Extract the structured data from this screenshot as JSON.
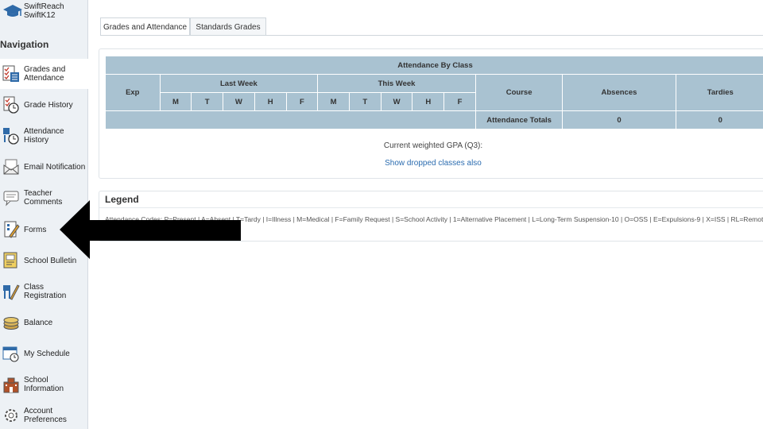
{
  "brand": {
    "line1": "SwiftReach",
    "line2": "SwiftK12"
  },
  "navigation": {
    "heading": "Navigation",
    "items": [
      {
        "label": "Grades and Attendance",
        "icon": "grades-attendance-icon",
        "active": true
      },
      {
        "label": "Grade History",
        "icon": "grade-history-icon"
      },
      {
        "label": "Attendance History",
        "icon": "attendance-history-icon"
      },
      {
        "label": "Email Notification",
        "icon": "email-icon"
      },
      {
        "label": "Teacher Comments",
        "icon": "comments-icon"
      },
      {
        "label": "Forms",
        "icon": "forms-icon"
      },
      {
        "label": "School Bulletin",
        "icon": "bulletin-icon"
      },
      {
        "label": "Class Registration",
        "icon": "registration-icon"
      },
      {
        "label": "Balance",
        "icon": "balance-icon"
      },
      {
        "label": "My Schedule",
        "icon": "schedule-icon"
      },
      {
        "label": "School Information",
        "icon": "school-icon"
      },
      {
        "label": "Account Preferences",
        "icon": "preferences-icon"
      }
    ]
  },
  "tabs": [
    {
      "label": "Grades and Attendance",
      "active": true
    },
    {
      "label": "Standards Grades",
      "active": false
    }
  ],
  "attendance": {
    "title": "Attendance By Class",
    "exp_header": "Exp",
    "last_week_header": "Last Week",
    "this_week_header": "This Week",
    "course_header": "Course",
    "absences_header": "Absences",
    "tardies_header": "Tardies",
    "days": [
      "M",
      "T",
      "W",
      "H",
      "F"
    ],
    "totals_label": "Attendance Totals",
    "totals_absences": "0",
    "totals_tardies": "0"
  },
  "gpa_text": "Current weighted GPA (Q3):",
  "show_dropped": "Show dropped classes also",
  "legend": {
    "title": "Legend",
    "text": "Attendance Codes: P=Present | A=Absent | T=Tardy | I=Illness | M=Medical | F=Family Request | S=School Activity | 1=Alternative Placement | L=Long-Term Suspension-10 | O=OSS | E=Expulsions-9 | X=ISS | RL=Remote"
  },
  "colors": {
    "table_header": "#a9c2d1",
    "link": "#2b6cb0",
    "arrow": "#000000"
  }
}
